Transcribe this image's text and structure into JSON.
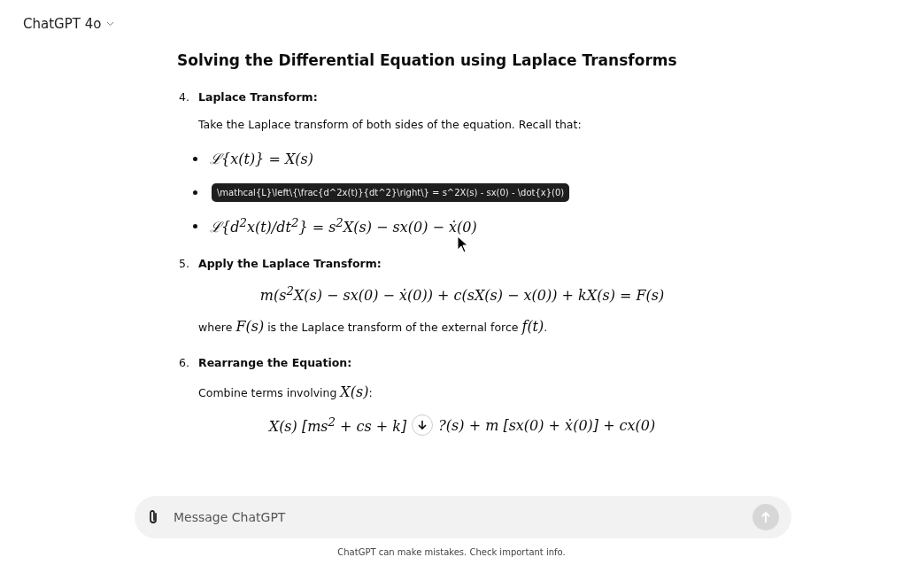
{
  "header": {
    "model": "ChatGPT 4o"
  },
  "title": "Solving the Differential Equation using Laplace Transforms",
  "steps": [
    {
      "number": "4.",
      "heading": "Laplace Transform",
      "colon": ":",
      "text": "Take the Laplace transform of both sides of the equation. Recall that:",
      "bullets": [
        {
          "kind": "formula",
          "text": "ℒ{x(t)} = X(s)"
        },
        {
          "kind": "tooltip",
          "text": "\\mathcal{L}\\left\\{\\frac{d^2x(t)}{dt^2}\\right\\} = s^2X(s) - sx(0) - \\dot{x}(0)"
        },
        {
          "kind": "formula",
          "text": "ℒ{d$^{2}$x(t)/dt$^{2}$} = s$^{2}$X(s) − sx(0) − ẋ(0)"
        }
      ]
    },
    {
      "number": "5.",
      "heading": "Apply the Laplace Transform",
      "colon": ":",
      "equation": [
        "m(s$^{2}$X(s) − sx(0) − ẋ(0)) + c(sX(s) − x(0)) + kX(s) = F(s)"
      ],
      "after": [
        "where ",
        "F(s)",
        " is the Laplace transform of the external force ",
        "f(t)",
        "."
      ]
    },
    {
      "number": "6.",
      "heading": "Rearrange the Equation",
      "colon": ":",
      "text_parts": [
        "Combine terms involving ",
        "X(s)",
        ":"
      ],
      "equation": [
        "X(s) [ms$^{2}$ + cs + k]",
        "?(s) + m [sx(0) + ẋ(0)] + cx(0)"
      ]
    }
  ],
  "composer": {
    "placeholder": "Message ChatGPT"
  },
  "footer": "ChatGPT can make mistakes. Check important info."
}
